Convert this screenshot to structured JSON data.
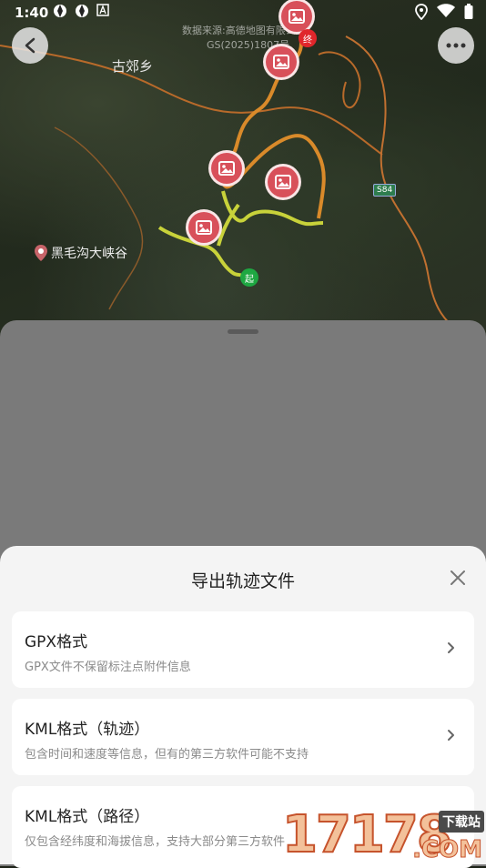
{
  "status": {
    "time": "1:40"
  },
  "map": {
    "attribution_line1": "数据来源:高德地图有限公司",
    "attribution_line2": "GS(2025)1807号",
    "place_label_town": "古郊乡",
    "poi_label": "黑毛沟大峡谷",
    "road_badge": "S84",
    "start_label": "起",
    "end_label": "终"
  },
  "dialog": {
    "title": "导出轨迹文件",
    "options": [
      {
        "title": "GPX格式",
        "desc": "GPX文件不保留标注点附件信息"
      },
      {
        "title": "KML格式（轨迹）",
        "desc": "包含时间和速度等信息，但有的第三方软件可能不支持"
      },
      {
        "title": "KML格式（路径）",
        "desc": "仅包含经纬度和海拔信息，支持大部分第三方软件"
      }
    ]
  },
  "watermark": {
    "digits": "17178",
    "site": "下载站",
    "domain": ".COM"
  }
}
